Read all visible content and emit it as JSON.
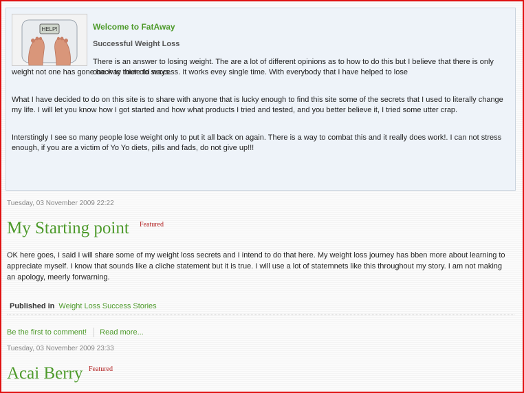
{
  "intro": {
    "welcome": "Welcome to FatAway",
    "subtitle": "Successful Weight Loss",
    "para1_line1": "There is an answer to losing weight. The are a lot of different opinions as to how to do this but I believe that there is only one way route to success. It works evey single time. With everybody that I have helped to lose",
    "para1_line2": "weight not one has gone back to thier old ways.",
    "para2": "What I have decided to do on this site is to share with anyone that is lucky enough to find this site some of the secrets that I used to literally change my life. I will let you know how I got started and how what products I tried and tested, and you better believe it, I tried some utter crap.",
    "para3": "Interstingly I see so many people lose weight only to put it all back on again. There is a way to combat this and it really does work!. I can not stress enough, if you are a victim of Yo Yo diets, pills and fads, do not give up!!!",
    "scale_display": "HELP!",
    "image_icon": "bathroom-scale-feet-image"
  },
  "posts": [
    {
      "date": "Tuesday, 03 November 2009 22:22",
      "title": "My Starting point",
      "badge": "Featured",
      "body": "OK here goes, I said I will share some of my weight loss secrets and I intend to do that here. My weight loss journey has bben more about learning to appreciate myself. I know that sounds like a cliche statement but it is true. I will use a lot of statemnets  like this throughout my story. I am not making an apology, meerly forwarning.",
      "published_label": "Published in",
      "category": "Weight Loss Success Stories",
      "comment_link": "Be the first to comment!",
      "read_more": "Read more..."
    },
    {
      "date": "Tuesday, 03 November 2009 23:33",
      "title": "Acai Berry",
      "badge": "Featured"
    }
  ],
  "colors": {
    "accent": "#4d9a2b",
    "featured": "#b22020",
    "intro_bg": "#eef3f9",
    "frame_border": "#e01010"
  }
}
